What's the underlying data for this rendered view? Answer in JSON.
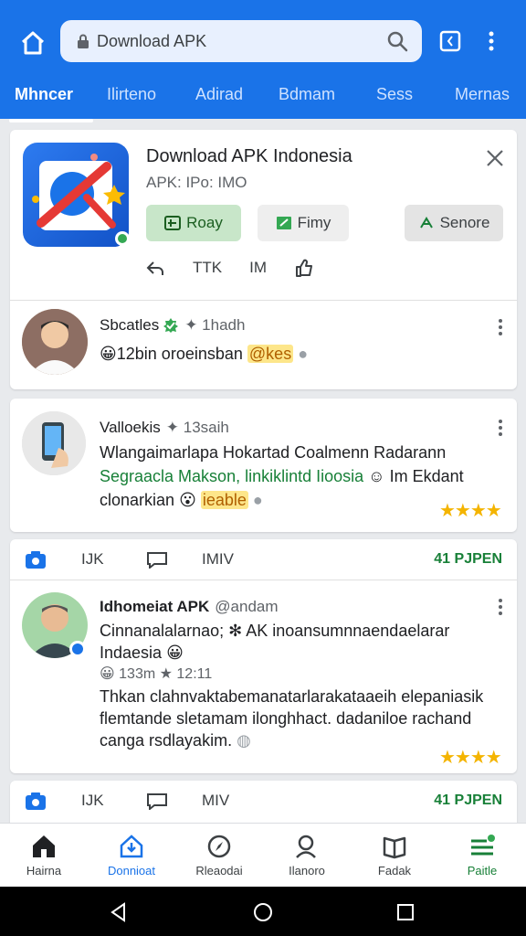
{
  "browser": {
    "search_text": "Download APK"
  },
  "tabs": [
    {
      "label": "Mhncer",
      "active": true
    },
    {
      "label": "Ilirteno",
      "active": false
    },
    {
      "label": "Adirad",
      "active": false
    },
    {
      "label": "Bdmam",
      "active": false
    },
    {
      "label": "Sess",
      "active": false
    },
    {
      "label": "Mernas",
      "active": false
    }
  ],
  "app_card": {
    "title": "Download APK Indonesia",
    "subtitle": "APK: IPo: IMO",
    "buttons": {
      "play": "Roay",
      "fimy": "Fimy",
      "senore": "Senore"
    },
    "actions": {
      "a2": "TTK",
      "a3": "IM"
    },
    "comment": {
      "author": "Sbcatles",
      "time": "1hadh",
      "text_before": "12bin oroeinsban",
      "highlight": "@kes"
    }
  },
  "post2": {
    "author": "Valloekis",
    "time": "13saih",
    "line1": "Wlangaimarlapa Hokartad Coalmenn Radarann",
    "line2": "Segraacla Makson, linkiklintd Iioosia",
    "line2_green": "Im Ekdant",
    "line3": "clonarkian",
    "highlight": "ieable",
    "stars": "★★★★"
  },
  "stat_row": {
    "count1": "IJK",
    "count2": "IMIV",
    "count3": "IJK",
    "count4": "MIV",
    "open": "41 PJPEN"
  },
  "post3": {
    "author": "Idhomeiat APK",
    "handle": "@andam",
    "line1": "Cinnanalalarnao; ✻ AK inoansumnnaendaelarar",
    "line2": "Indaesia",
    "meta1": "133m",
    "meta2": "12:11",
    "body1": "Thkan clahnvaktabemanatarlarakataaeih elepaniasik",
    "body2": "flemtande sletamam ilonghhact. dadaniloe rachand",
    "body3": "canga rsdlayakim.",
    "stars": "★★★★"
  },
  "bottom_nav": [
    {
      "label": "Hairna",
      "icon": "home-icon"
    },
    {
      "label": "Donnioat",
      "icon": "download-icon",
      "active": true
    },
    {
      "label": "Rleaodai",
      "icon": "compass-icon"
    },
    {
      "label": "Ilanoro",
      "icon": "person-search-icon"
    },
    {
      "label": "Fadak",
      "icon": "book-icon"
    },
    {
      "label": "Paitle",
      "icon": "profile-icon"
    }
  ],
  "colors": {
    "accent": "#1a73e8",
    "green": "#188038",
    "star": "#f4b400"
  }
}
